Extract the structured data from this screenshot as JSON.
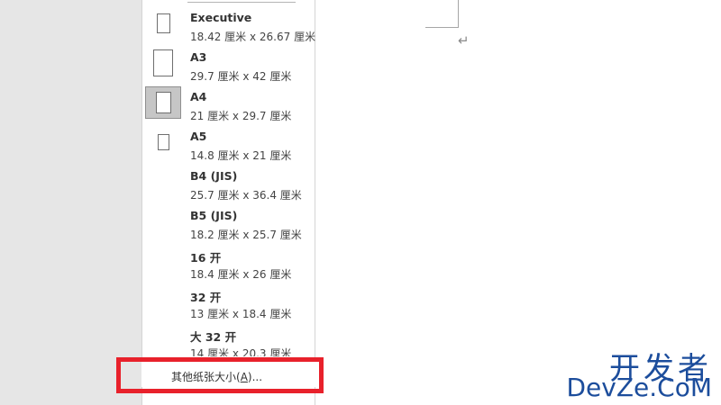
{
  "paper_size_menu": {
    "items": [
      {
        "name": "Executive",
        "dims": "18.42 厘米 x 26.67 厘米",
        "icon": "paper-executive-icon",
        "selected": false
      },
      {
        "name": "A3",
        "dims": "29.7 厘米 x 42 厘米",
        "icon": "paper-a3-icon",
        "selected": false
      },
      {
        "name": "A4",
        "dims": "21 厘米 x 29.7 厘米",
        "icon": "paper-a4-icon",
        "selected": true
      },
      {
        "name": "A5",
        "dims": "14.8 厘米 x 21 厘米",
        "icon": "paper-a5-icon",
        "selected": false
      },
      {
        "name": "B4 (JIS)",
        "dims": "25.7 厘米 x 36.4 厘米",
        "icon": "",
        "selected": false
      },
      {
        "name": "B5 (JIS)",
        "dims": "18.2 厘米 x 25.7 厘米",
        "icon": "",
        "selected": false
      },
      {
        "name": "16 开",
        "dims": "18.4 厘米 x 26 厘米",
        "icon": "",
        "selected": false
      },
      {
        "name": "32 开",
        "dims": "13 厘米 x 18.4 厘米",
        "icon": "",
        "selected": false
      },
      {
        "name": "大 32 开",
        "dims": "14 厘米 x 20.3 厘米",
        "icon": "",
        "selected": false
      }
    ],
    "more_sizes": {
      "label_prefix": "其他纸张大小(",
      "accelerator": "A",
      "label_suffix": ")..."
    }
  },
  "document": {
    "paragraph_mark": "↵"
  },
  "watermark": {
    "chinese": "开发者",
    "english": "DevZe.CoM"
  },
  "colors": {
    "highlight": "#e8212b",
    "selected_item_bg": "#c6c6c6",
    "watermark": "#1c4d9c"
  }
}
